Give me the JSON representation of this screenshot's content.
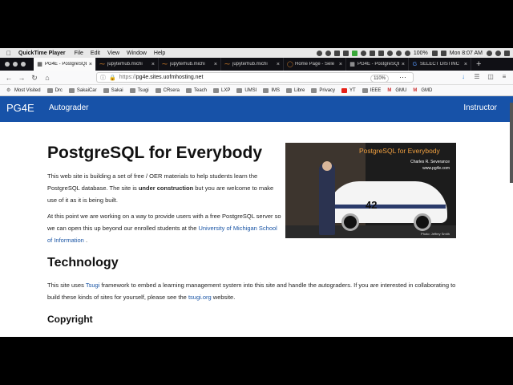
{
  "menubar": {
    "app": "QuickTime Player",
    "menus": [
      "File",
      "Edit",
      "View",
      "Window",
      "Help"
    ],
    "battery": "100%",
    "clock": "Mon 8:07 AM"
  },
  "tabs": [
    {
      "label": "PG4E - PostgreSQL fo",
      "active": true
    },
    {
      "label": "jupyterhub.michi",
      "active": false
    },
    {
      "label": "jupyterhub.michi",
      "active": false
    },
    {
      "label": "jupyterhub.michi",
      "active": false
    },
    {
      "label": "Home Page - Sele",
      "active": false
    },
    {
      "label": "PG4E - PostgreSQL fo",
      "active": false
    },
    {
      "label": "SELECT DISTINC",
      "active": false
    }
  ],
  "nav": {
    "url_scheme": "https://",
    "url_host": "pg4e.sites.uofmhosting.net",
    "zoom": "110%"
  },
  "bookmarks": [
    "Most Visited",
    "Drc",
    "SakaiCar",
    "Sakai",
    "Tsugi",
    "CRsera",
    "Teach",
    "LXP",
    "UMSI",
    "IMS",
    "Libre",
    "Privacy",
    "YT",
    "IEEE",
    "GMU",
    "GMD"
  ],
  "header": {
    "brand": "PG4E",
    "autograder": "Autograder",
    "instructor": "Instructor"
  },
  "main": {
    "title": "PostgreSQL for Everybody",
    "p1_a": "This web site is building a set of free / OER materials to help students learn the PostgreSQL database. The site is ",
    "p1_bold": "under construction",
    "p1_b": " but you are welcome to make use of it as it is being built.",
    "p2_a": "At this point we are working on a way to provide users with a free PostgreSQL server so we can open this up beyond our enrolled students at the ",
    "p2_link": "University of Michigan School of Information",
    "p2_b": " .",
    "tech_heading": "Technology",
    "tech_a": "This site uses ",
    "tech_link1": "Tsugi",
    "tech_b": " framework to embed a learning management system into this site and handle the autograders. If you are interested in collaborating to build these kinds of sites for yourself, please see the ",
    "tech_link2": "tsugi.org",
    "tech_c": " website.",
    "copyright_heading": "Copyright"
  },
  "photo": {
    "title": "PostgreSQL for Everybody",
    "name": "Charles R. Severance",
    "site": "www.pg4e.com",
    "number": "42",
    "credit": "Photo: Jeffrey Smith"
  }
}
